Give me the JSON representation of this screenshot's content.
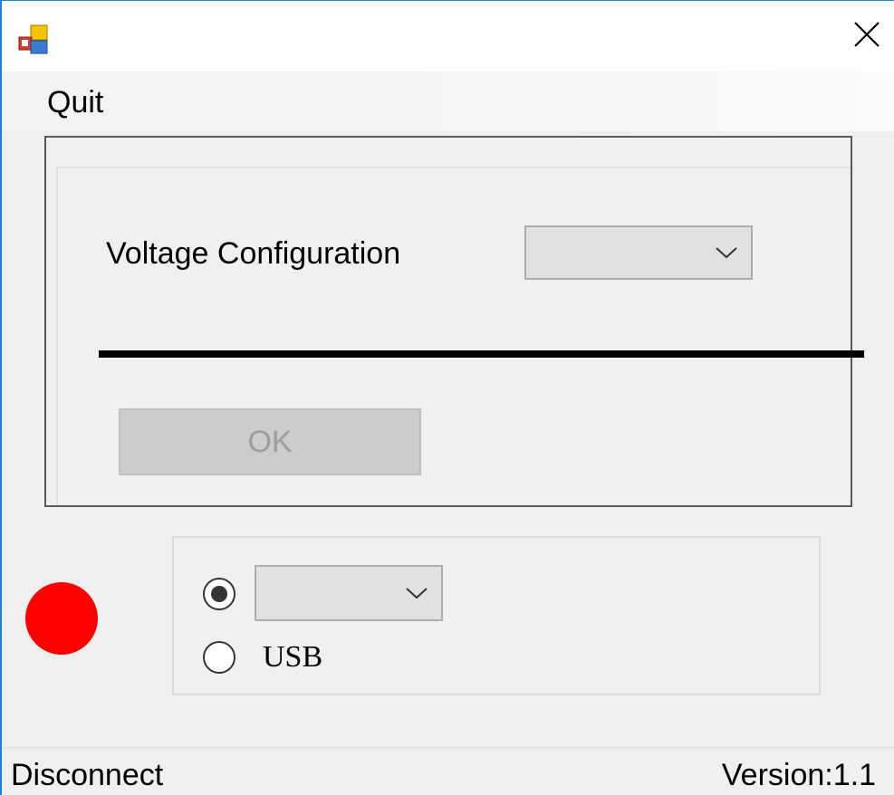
{
  "window": {
    "title": "",
    "close_icon": "close-icon",
    "app_icon": "app-icon",
    "accent_color": "#1883d7"
  },
  "menu": {
    "quit_label": "Quit"
  },
  "config": {
    "voltage_label": "Voltage Configuration",
    "voltage_value": "",
    "ok_label": "OK",
    "ok_enabled": false
  },
  "connection": {
    "status_led_color": "#ff0000",
    "serial_selected": true,
    "port_value": "",
    "usb_label": "USB",
    "usb_selected": false
  },
  "statusbar": {
    "left_text": "Disconnect",
    "right_text": "Version:1.1"
  }
}
